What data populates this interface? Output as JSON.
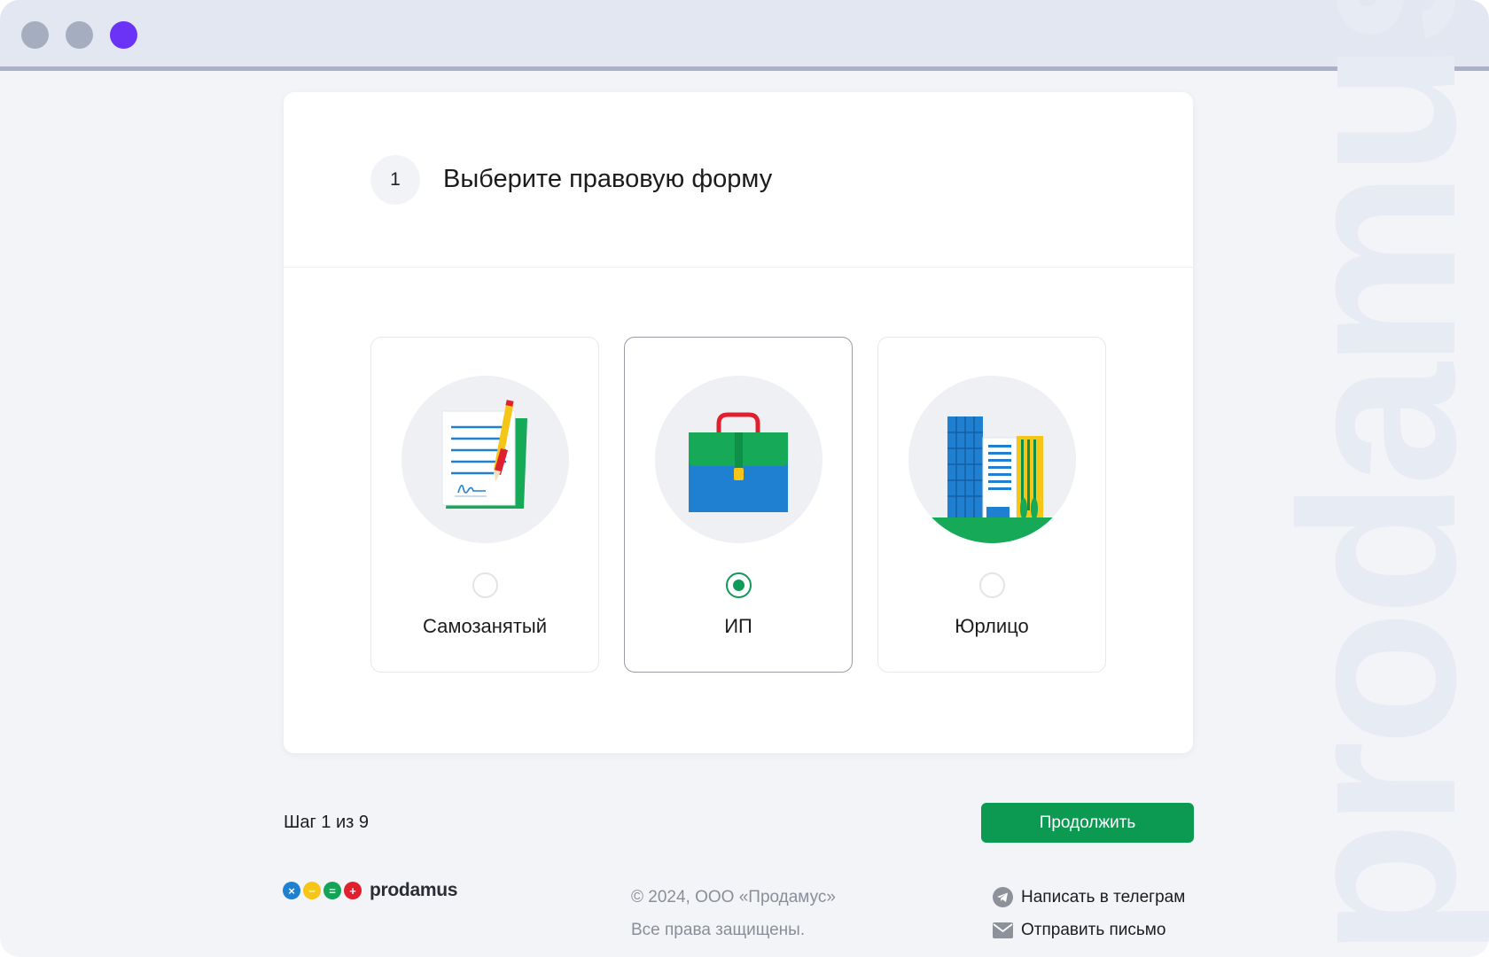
{
  "window": {
    "controls": [
      "close",
      "minimize",
      "maximize"
    ]
  },
  "watermark": "prodamus",
  "card": {
    "step_number": "1",
    "title": "Выберите правовую форму",
    "options": [
      {
        "label": "Самозанятый",
        "icon": "document-signature-icon",
        "selected": false
      },
      {
        "label": "ИП",
        "icon": "briefcase-icon",
        "selected": true
      },
      {
        "label": "Юрлицо",
        "icon": "office-buildings-icon",
        "selected": false
      }
    ]
  },
  "navigation": {
    "step_text": "Шаг 1 из 9",
    "continue_label": "Продолжить"
  },
  "footer": {
    "logo_text": "prodamus",
    "copyright_line1": "© 2024, ООО «Продамус»",
    "copyright_line2": "Все права защищены.",
    "telegram_link": "Написать в телеграм",
    "email_link": "Отправить письмо"
  },
  "colors": {
    "accent_green": "#0c9a52",
    "window_control_active": "#6a33f5",
    "logo_blue": "#1f7fd0",
    "logo_yellow": "#f5c518",
    "logo_green": "#13a456",
    "logo_red": "#e0202f"
  }
}
